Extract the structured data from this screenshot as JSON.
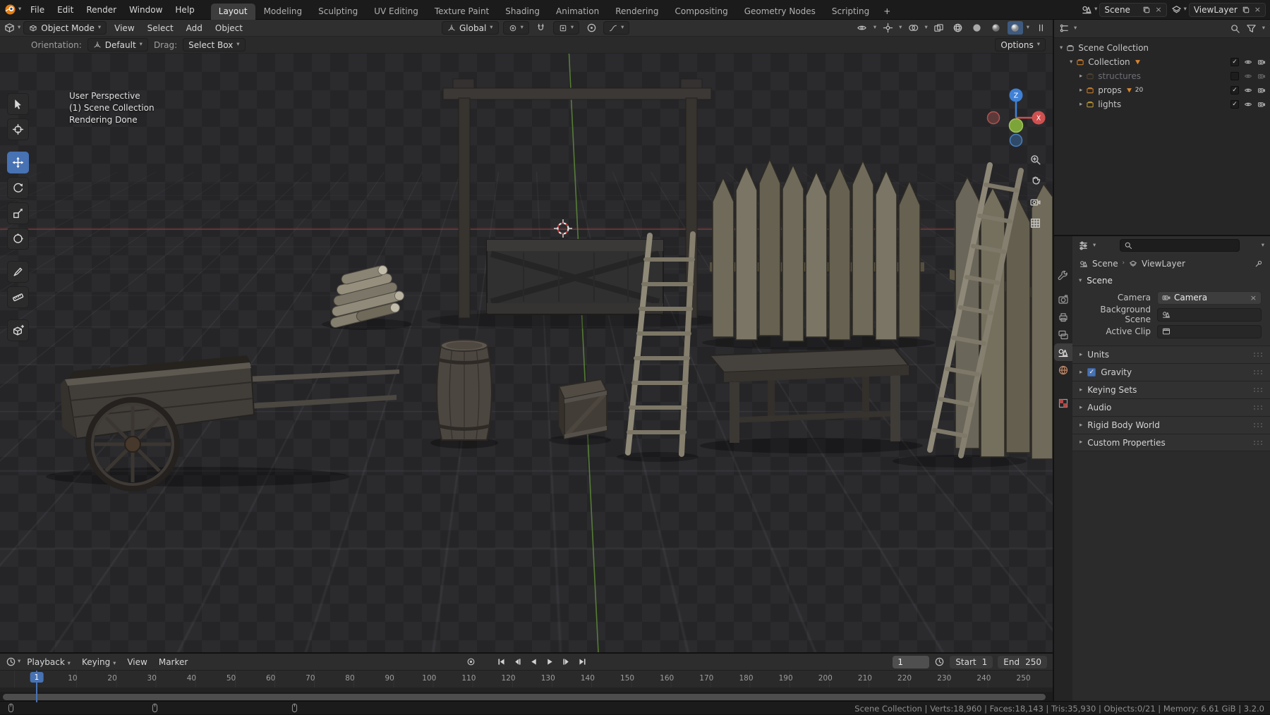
{
  "icons": {
    "caret_down": "▾",
    "caret_right": "▸",
    "close": "×",
    "check": "✓",
    "breadcrumb_sep": "›"
  },
  "topbar": {
    "menus": [
      "File",
      "Edit",
      "Render",
      "Window",
      "Help"
    ],
    "tabs": [
      "Layout",
      "Modeling",
      "Sculpting",
      "UV Editing",
      "Texture Paint",
      "Shading",
      "Animation",
      "Rendering",
      "Compositing",
      "Geometry Nodes",
      "Scripting"
    ],
    "add_tab": "+",
    "scene_value": "Scene",
    "viewlayer_value": "ViewLayer"
  },
  "viewport": {
    "mode": "Object Mode",
    "menus": [
      "View",
      "Select",
      "Add",
      "Object"
    ],
    "orientation": "Global",
    "tool_settings": {
      "orientation_label": "Orientation:",
      "orientation_value": "Default",
      "drag_label": "Drag:",
      "drag_value": "Select Box",
      "options_label": "Options"
    },
    "overlay_info": [
      "User Perspective",
      "(1) Scene Collection",
      "Rendering Done"
    ],
    "gizmo_axes": {
      "x": "X",
      "z": "Z"
    }
  },
  "outliner": {
    "root": "Scene Collection",
    "rows": [
      {
        "label": "Collection"
      },
      {
        "label": "structures"
      },
      {
        "label": "props",
        "badge": "20"
      },
      {
        "label": "lights"
      }
    ]
  },
  "properties": {
    "breadcrumb": {
      "scene": "Scene",
      "viewlayer": "ViewLayer"
    },
    "scene_panel": {
      "title": "Scene",
      "camera_label": "Camera",
      "camera_value": "Camera",
      "background_label": "Background Scene",
      "clip_label": "Active Clip"
    },
    "sections": [
      "Units",
      "Gravity",
      "Keying Sets",
      "Audio",
      "Rigid Body World",
      "Custom Properties"
    ]
  },
  "timeline": {
    "menus": [
      "Playback",
      "Keying",
      "View",
      "Marker"
    ],
    "frame_field": "1",
    "start_label": "Start",
    "start_value": "1",
    "end_label": "End",
    "end_value": "250",
    "playhead_label": "1",
    "ruler": [
      10,
      20,
      30,
      40,
      50,
      60,
      70,
      80,
      90,
      100,
      110,
      120,
      130,
      140,
      150,
      160,
      170,
      180,
      190,
      200,
      210,
      220,
      230,
      240,
      250
    ]
  },
  "statusbar": {
    "text": "Scene Collection | Verts:18,960 | Faces:18,143 | Tris:35,930 | Objects:0/21 | Memory: 6.61 GiB | 3.2.0"
  },
  "colors": {
    "accent": "#4772b3",
    "collection_orange": "#d9862c",
    "axis_red": "#b84444",
    "axis_green": "#6f9d3f",
    "axis_blue": "#3f81d6"
  }
}
